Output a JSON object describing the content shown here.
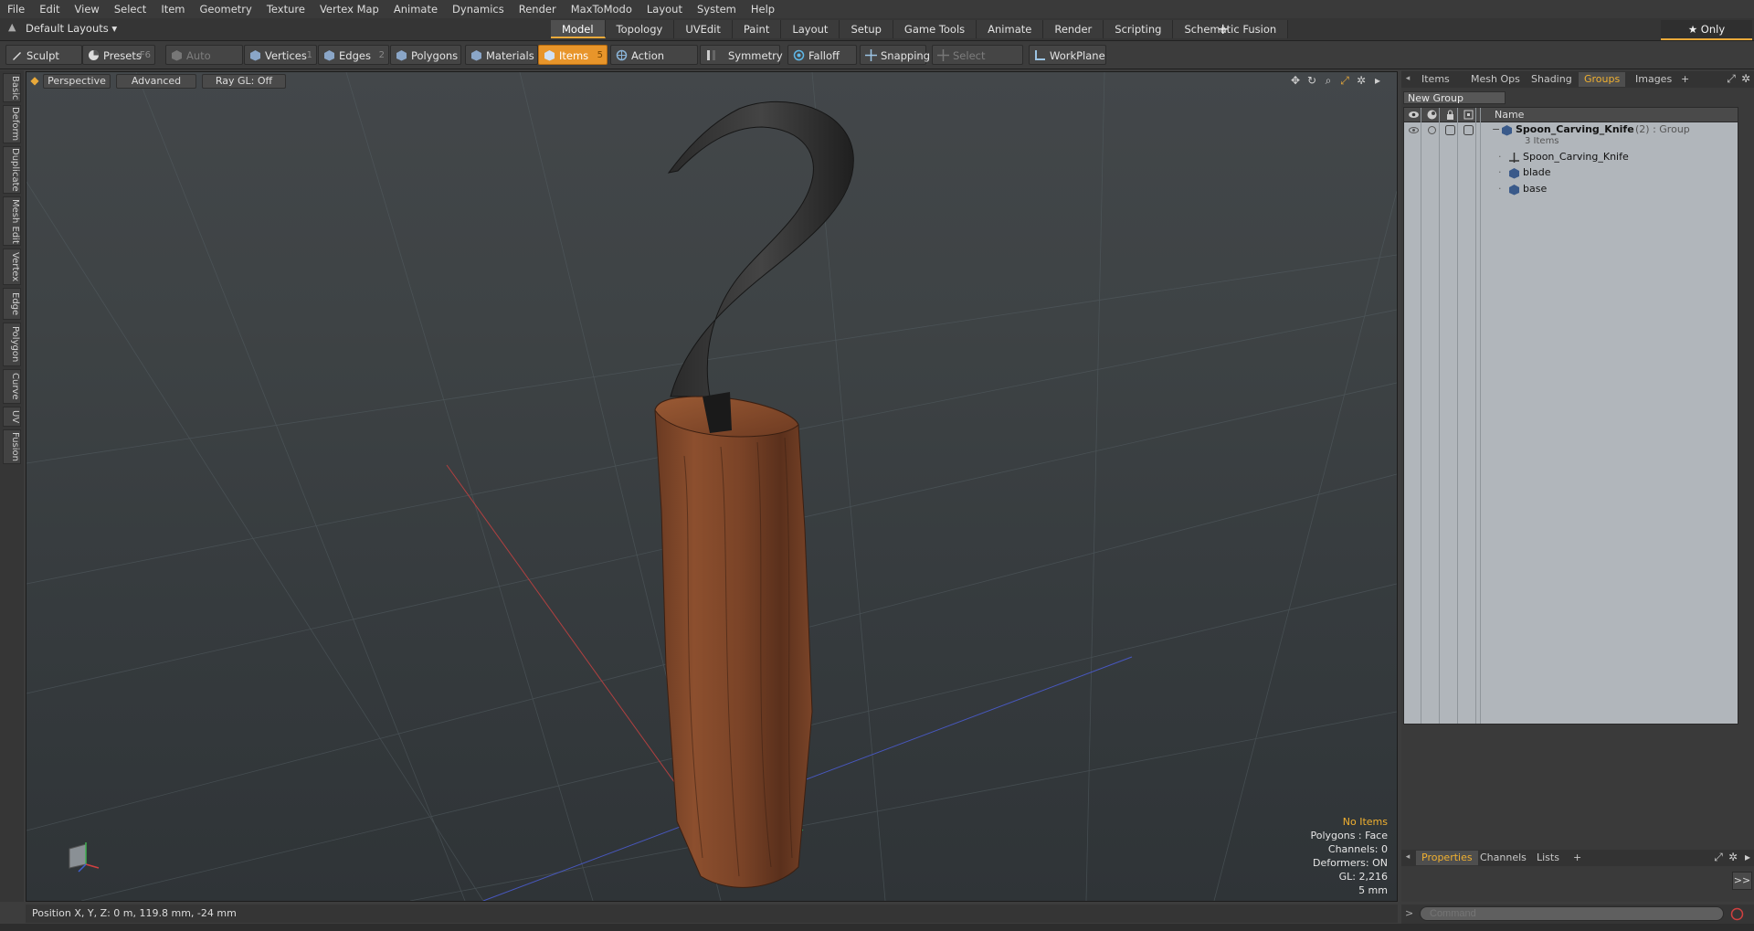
{
  "menu": [
    "File",
    "Edit",
    "View",
    "Select",
    "Item",
    "Geometry",
    "Texture",
    "Vertex Map",
    "Animate",
    "Dynamics",
    "Render",
    "MaxToModo",
    "Layout",
    "System",
    "Help"
  ],
  "layout_select": "Default Layouts ▾",
  "modes": [
    "Model",
    "Topology",
    "UVEdit",
    "Paint",
    "Layout",
    "Setup",
    "Game Tools",
    "Animate",
    "Render",
    "Scripting",
    "Schematic Fusion"
  ],
  "active_mode": "Model",
  "add_tab": "+",
  "only_button": "★  Only",
  "toolbar": {
    "sculpt": "Sculpt",
    "presets": "Presets",
    "presets_key": "F6",
    "auto_select": "Auto Select",
    "vertices": "Vertices",
    "vertices_key": "1",
    "edges": "Edges",
    "edges_key": "2",
    "polygons": "Polygons",
    "materials": "Materials",
    "items": "Items",
    "items_key": "5",
    "action_center": "Action Center",
    "symmetry": "Symmetry",
    "falloff": "Falloff",
    "snapping": "Snapping",
    "select_through": "Select Through",
    "workplane": "WorkPlane"
  },
  "left_tabs": [
    "Basic",
    "Deform",
    "Duplicate",
    "Mesh Edit",
    "Vertex",
    "Edge",
    "Polygon",
    "Curve",
    "UV",
    "Fusion"
  ],
  "viewport": {
    "view": "Perspective",
    "shading": "Advanced",
    "raygl": "Ray GL: Off",
    "info": {
      "selection": "No Items",
      "polygons": "Polygons : Face",
      "channels": "Channels: 0",
      "deformers": "Deformers: ON",
      "gl": "GL: 2,216",
      "scale": "5 mm"
    }
  },
  "status": "Position X, Y, Z:   0 m, 119.8 mm, -24 mm",
  "right_tabs": [
    "Items",
    "Mesh Ops",
    "Shading",
    "Groups",
    "Images",
    "+"
  ],
  "active_right_tab": "Groups",
  "new_group": "New Group",
  "tree": {
    "header_name": "Name",
    "group_name": "Spoon_Carving_Knife",
    "group_suffix": " (2) : Group",
    "group_count": "3 Items",
    "children": [
      "Spoon_Carving_Knife",
      "blade",
      "base"
    ]
  },
  "bottom_tabs": [
    "Properties",
    "Channels",
    "Lists",
    "+"
  ],
  "active_bottom_tab": "Properties",
  "expand_button": ">>",
  "command_placeholder": "Command",
  "colors": {
    "accent": "#e8952a",
    "highlight_text": "#f0b030"
  }
}
